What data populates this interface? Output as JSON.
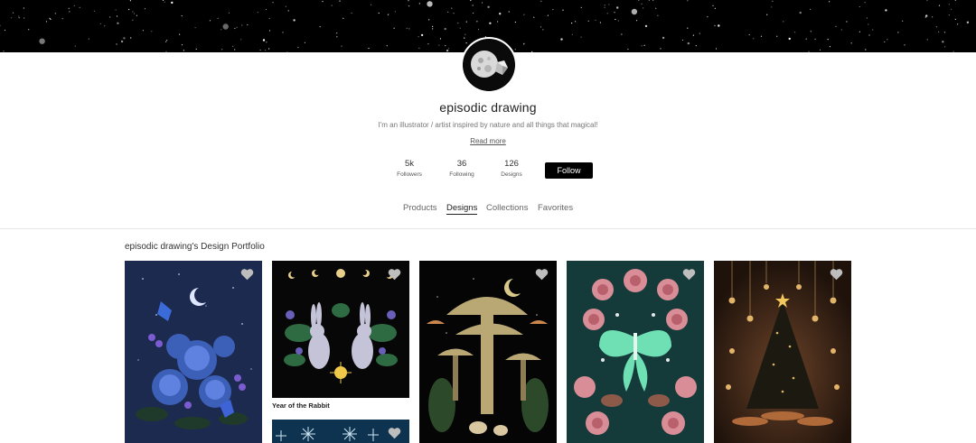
{
  "profile": {
    "name": "episodic drawing",
    "bio": "I'm an illustrator / artist inspired by nature and all things that magical!",
    "read_more": "Read more"
  },
  "stats": [
    {
      "value": "5k",
      "label": "Followers"
    },
    {
      "value": "36",
      "label": "Following"
    },
    {
      "value": "126",
      "label": "Designs"
    }
  ],
  "follow_label": "Follow",
  "tabs": [
    {
      "label": "Products",
      "active": false
    },
    {
      "label": "Designs",
      "active": true
    },
    {
      "label": "Collections",
      "active": false
    },
    {
      "label": "Favorites",
      "active": false
    }
  ],
  "portfolio": {
    "title": "episodic drawing's Design Portfolio",
    "designs": [
      {
        "title": "",
        "icon": "heart-icon"
      },
      {
        "title": "Year of the Rabbit",
        "icon": "heart-icon"
      },
      {
        "title": "",
        "icon": "heart-icon"
      },
      {
        "title": "",
        "icon": "heart-icon"
      },
      {
        "title": "",
        "icon": "heart-icon"
      },
      {
        "title": "",
        "icon": "heart-icon"
      }
    ]
  },
  "colors": {
    "follow_button": "#000000",
    "banner": "#000000",
    "card_blue": "#1b2a4e",
    "card_teal": "#153a3a",
    "card_brown": "#2a1a10"
  }
}
